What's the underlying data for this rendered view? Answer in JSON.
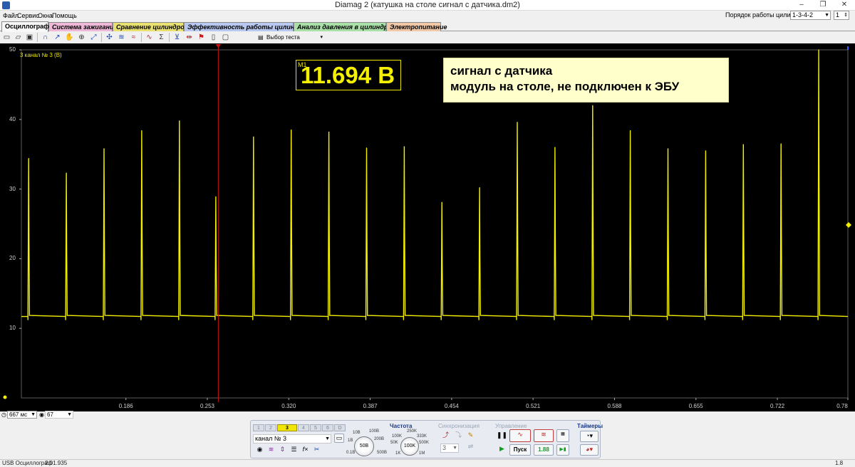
{
  "window": {
    "title": "Diamag 2 (катушка на столе сигнал с датчика.dm2)",
    "controls": [
      "–",
      "❐",
      "✕"
    ]
  },
  "menu": [
    "Файл",
    "Сервис",
    "Окна",
    "Помощь"
  ],
  "cylinder_order": {
    "label": "Порядок работы цилиндров",
    "value": "1-3-4-2",
    "cylinder": "1"
  },
  "tabs": [
    {
      "label": "Осциллограф",
      "color": "#f7f7f7"
    },
    {
      "label": "Система зажигания",
      "color": "#f0b8d8"
    },
    {
      "label": "Сравнение цилиндров",
      "color": "#e8e070"
    },
    {
      "label": "Эффективность работы цилиндров",
      "color": "#b8c8f0"
    },
    {
      "label": "Анализ давления в цилиндре",
      "color": "#a8e0a8"
    },
    {
      "label": "Электропитание",
      "color": "#f0c8a8"
    }
  ],
  "toolbar": {
    "icons": [
      "new-file-icon",
      "open-icon",
      "save-icon",
      "curve-icon",
      "cursor-icon",
      "hand-icon",
      "zoom-icon",
      "fit-icon",
      "compare-icon",
      "marker-icon",
      "stats-icon",
      "filter-icon",
      "measure-icon",
      "flag-icon",
      "page-icon"
    ],
    "test_selector": "Выбор теста"
  },
  "scope": {
    "channel_label": "3  канал № 3 (В)",
    "measurement_label": "M1",
    "measurement_value": "11.694 В",
    "note_lines": [
      "сигнал с датчика",
      "модуль на столе, не подключен к ЭБУ"
    ],
    "colors": {
      "trace": "#f2ee00",
      "cursor": "#d01010",
      "background": "#000000"
    }
  },
  "chart_data": {
    "type": "line",
    "title": "",
    "xlabel": "",
    "ylabel": "",
    "xlim": [
      0.1,
      0.78
    ],
    "ylim": [
      0,
      50
    ],
    "x_ticks": [
      "0.186",
      "0.253",
      "0.320",
      "0.387",
      "0.454",
      "0.521",
      "0.588",
      "0.655",
      "0.722",
      "0.78"
    ],
    "y_ticks": [
      "10",
      "20",
      "30",
      "40",
      "50"
    ],
    "baseline": 11.7,
    "cursor_x": 0.262,
    "pulses": [
      {
        "x": 0.106,
        "peak": 34.4,
        "mid": 22.5
      },
      {
        "x": 0.137,
        "peak": 32.3,
        "mid": 21.6
      },
      {
        "x": 0.168,
        "peak": 35.8,
        "mid": 23.4
      },
      {
        "x": 0.199,
        "peak": 38.4,
        "mid": 25.0
      },
      {
        "x": 0.23,
        "peak": 39.8,
        "mid": 25.6
      },
      {
        "x": 0.26,
        "peak": 28.9,
        "mid": 19.5
      },
      {
        "x": 0.291,
        "peak": 37.5,
        "mid": 24.5
      },
      {
        "x": 0.322,
        "peak": 38.5,
        "mid": 25.0
      },
      {
        "x": 0.353,
        "peak": 38.2,
        "mid": 24.8
      },
      {
        "x": 0.384,
        "peak": 35.9,
        "mid": 23.4
      },
      {
        "x": 0.415,
        "peak": 36.1,
        "mid": 23.5
      },
      {
        "x": 0.446,
        "peak": 28.1,
        "mid": 19.0
      },
      {
        "x": 0.477,
        "peak": 30.2,
        "mid": 20.3
      },
      {
        "x": 0.508,
        "peak": 39.6,
        "mid": 25.5
      },
      {
        "x": 0.539,
        "peak": 36.0,
        "mid": 23.5
      },
      {
        "x": 0.57,
        "peak": 42.0,
        "mid": 26.8
      },
      {
        "x": 0.601,
        "peak": 38.4,
        "mid": 25.0
      },
      {
        "x": 0.632,
        "peak": 35.8,
        "mid": 23.4
      },
      {
        "x": 0.663,
        "peak": 35.5,
        "mid": 23.2
      },
      {
        "x": 0.694,
        "peak": 36.4,
        "mid": 23.7
      },
      {
        "x": 0.725,
        "peak": 36.5,
        "mid": 23.8
      },
      {
        "x": 0.756,
        "peak": 50.0,
        "mid": 31.5
      },
      {
        "x": 0.787,
        "peak": 33.2,
        "mid": 22.0
      }
    ]
  },
  "status_controls": {
    "period": "667 мс",
    "count": "67"
  },
  "control_panel": {
    "channels": [
      "1",
      "2",
      "3",
      "4",
      "5",
      "6",
      "D"
    ],
    "active_channel": "3",
    "channel_name": "канал № 3",
    "voltage_knob": {
      "value": "50В",
      "labels": [
        "10В",
        "100В",
        "1В",
        "200В",
        "0.1В",
        "500В"
      ]
    },
    "frequency": {
      "title": "Частота",
      "value": "100K",
      "labels": [
        "250K",
        "100K",
        "333K",
        "50K",
        "500K",
        "1K",
        "1M"
      ]
    },
    "sync": {
      "title": "Синхронизация",
      "value": "3"
    },
    "control": {
      "title": "Управление",
      "start": "Пуск",
      "ratio": "1.88"
    },
    "timers": {
      "title": "Таймеры"
    }
  },
  "statusbar": {
    "device": "USB Осциллограф",
    "version": "2.01.935",
    "right": "1.8"
  }
}
